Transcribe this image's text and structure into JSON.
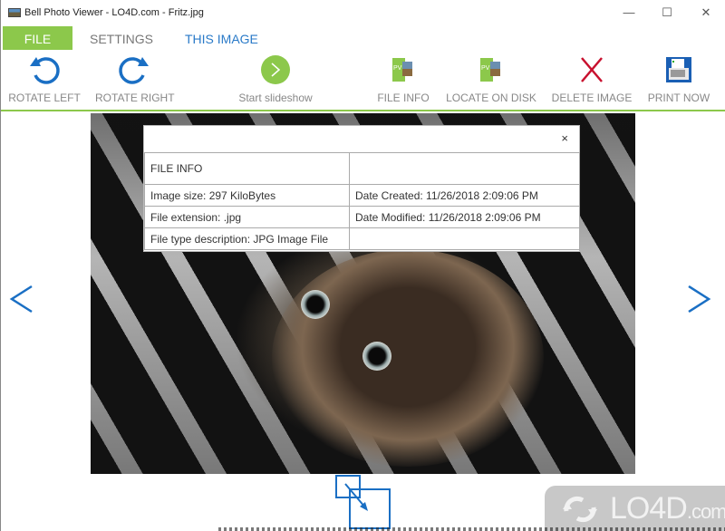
{
  "window": {
    "title": "Bell Photo Viewer - LO4D.com - Fritz.jpg",
    "minimize_glyph": "—",
    "maximize_glyph": "☐",
    "close_glyph": "✕"
  },
  "menu": {
    "tabs": [
      {
        "label": "FILE",
        "active": true
      },
      {
        "label": "SETTINGS",
        "active": false
      },
      {
        "label": "THIS IMAGE",
        "active": false
      }
    ]
  },
  "toolbar": {
    "items": [
      {
        "label": "ROTATE LEFT",
        "icon": "rotate-left-icon"
      },
      {
        "label": "ROTATE RIGHT",
        "icon": "rotate-right-icon"
      },
      {
        "label": "Start slideshow",
        "icon": "play-icon"
      },
      {
        "label": "FILE INFO",
        "icon": "file-info-icon"
      },
      {
        "label": "LOCATE ON DISK",
        "icon": "locate-icon"
      },
      {
        "label": "DELETE IMAGE",
        "icon": "delete-icon"
      },
      {
        "label": "PRINT NOW",
        "icon": "printer-icon"
      }
    ],
    "icon_badge_text": "PV"
  },
  "file_info": {
    "close_glyph": "×",
    "title": "FILE INFO",
    "rows": [
      {
        "left": "Image size: 297 KiloBytes",
        "right": "Date Created: 11/26/2018 2:09:06 PM"
      },
      {
        "left": "File extension: .jpg",
        "right": "Date Modified: 11/26/2018 2:09:06 PM"
      },
      {
        "left": "File type description: JPG Image File",
        "right": ""
      }
    ]
  },
  "navigation": {
    "prev_glyph": "<",
    "next_glyph": ">"
  },
  "watermark": {
    "text": "LO4D",
    "suffix": ".com"
  },
  "colors": {
    "accent_green": "#8cc84b",
    "accent_blue": "#2a7ac8",
    "delete_red": "#c8102e"
  }
}
